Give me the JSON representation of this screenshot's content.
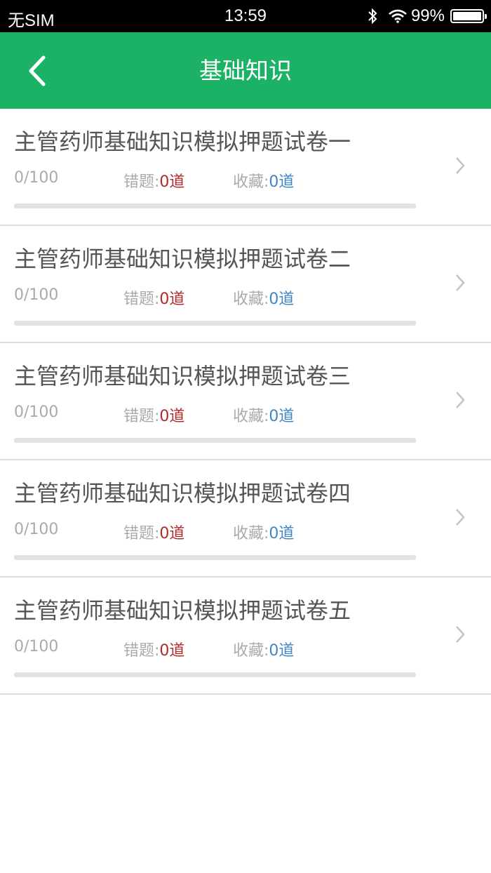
{
  "status_bar": {
    "carrier": "无SIM",
    "time": "13:59",
    "battery_text": "99%",
    "battery_level": 0.99
  },
  "navbar": {
    "title": "基础知识",
    "back_icon": "chevron-left-icon"
  },
  "colors": {
    "accent": "#1bb265",
    "wrong": "#b22a2a",
    "favorite": "#3f86c6"
  },
  "papers": [
    {
      "title": "主管药师基础知识模拟押题试卷一",
      "progress": "0/100",
      "progress_fraction": 0,
      "wrong_label": "错题:",
      "wrong_value": "0道",
      "fav_label": "收藏:",
      "fav_value": "0道"
    },
    {
      "title": "主管药师基础知识模拟押题试卷二",
      "progress": "0/100",
      "progress_fraction": 0,
      "wrong_label": "错题:",
      "wrong_value": "0道",
      "fav_label": "收藏:",
      "fav_value": "0道"
    },
    {
      "title": "主管药师基础知识模拟押题试卷三",
      "progress": "0/100",
      "progress_fraction": 0,
      "wrong_label": "错题:",
      "wrong_value": "0道",
      "fav_label": "收藏:",
      "fav_value": "0道"
    },
    {
      "title": "主管药师基础知识模拟押题试卷四",
      "progress": "0/100",
      "progress_fraction": 0,
      "wrong_label": "错题:",
      "wrong_value": "0道",
      "fav_label": "收藏:",
      "fav_value": "0道"
    },
    {
      "title": "主管药师基础知识模拟押题试卷五",
      "progress": "0/100",
      "progress_fraction": 0,
      "wrong_label": "错题:",
      "wrong_value": "0道",
      "fav_label": "收藏:",
      "fav_value": "0道"
    }
  ]
}
